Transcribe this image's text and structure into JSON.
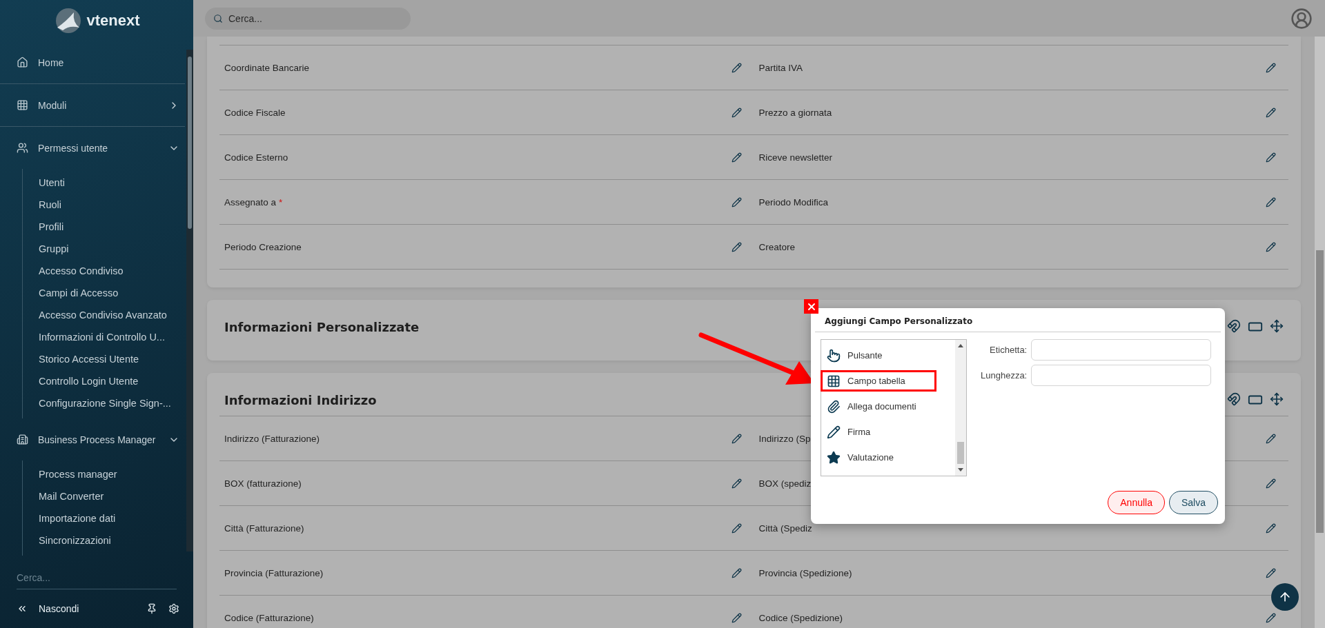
{
  "sidebar": {
    "logo_text": "vtenext",
    "menu": [
      {
        "kind": "link",
        "label": "Home"
      },
      {
        "kind": "group",
        "label": "Moduli",
        "expanded": false
      },
      {
        "kind": "group",
        "label": "Permessi utente",
        "expanded": true,
        "children": [
          "Utenti",
          "Ruoli",
          "Profili",
          "Gruppi",
          "Accesso Condiviso",
          "Campi di Accesso",
          "Accesso Condiviso Avanzato",
          "Informazioni di Controllo U...",
          "Storico Accessi Utente",
          "Controllo Login Utente",
          "Configurazione Single Sign-..."
        ]
      },
      {
        "kind": "group",
        "label": "Business Process Manager",
        "expanded": true,
        "children": [
          "Process manager",
          "Mail Converter",
          "Importazione dati",
          "Sincronizzazioni"
        ]
      }
    ],
    "search": {
      "placeholder": "Cerca..."
    },
    "hide_label": "Nascondi"
  },
  "topbar": {
    "search": {
      "placeholder": "Cerca..."
    }
  },
  "sections": [
    {
      "rows": [
        {
          "left": {
            "label": "Coordinate Bancarie"
          },
          "right": {
            "label": "Partita IVA"
          }
        },
        {
          "left": {
            "label": "Codice Fiscale"
          },
          "right": {
            "label": "Prezzo a giornata"
          }
        },
        {
          "left": {
            "label": "Codice Esterno"
          },
          "right": {
            "label": "Riceve newsletter"
          }
        },
        {
          "left": {
            "label": "Assegnato a",
            "required_mark": "*"
          },
          "right": {
            "label": "Periodo Modifica"
          }
        },
        {
          "left": {
            "label": "Periodo Creazione"
          },
          "right": {
            "label": "Creatore"
          }
        }
      ]
    },
    {
      "title": "Informazioni Personalizzate"
    },
    {
      "title": "Informazioni Indirizzo",
      "rows": [
        {
          "left": {
            "label": "Indirizzo (Fatturazione)"
          },
          "right": {
            "label": "Indirizzo (Sp"
          }
        },
        {
          "left": {
            "label": "BOX (fatturazione)"
          },
          "right": {
            "label": "BOX (spediz"
          }
        },
        {
          "left": {
            "label": "Città (Fatturazione)"
          },
          "right": {
            "label": "Città (Spediz"
          }
        },
        {
          "left": {
            "label": "Provincia (Fatturazione)"
          },
          "right": {
            "label": "Provincia (Spedizione)"
          }
        },
        {
          "left": {
            "label": "Codice (Fatturazione)"
          },
          "right": {
            "label": "Codice (Spedizione)"
          }
        }
      ]
    }
  ],
  "dialog": {
    "title": "Aggiungi Campo Personalizzato",
    "field_types": [
      {
        "label": "Pulsante",
        "highlighted": false
      },
      {
        "label": "Campo tabella",
        "highlighted": true
      },
      {
        "label": "Allega documenti",
        "highlighted": false
      },
      {
        "label": "Firma",
        "highlighted": false
      },
      {
        "label": "Valutazione",
        "highlighted": false
      }
    ],
    "fields": [
      {
        "label": "Etichetta:"
      },
      {
        "label": "Lunghezza:"
      }
    ],
    "buttons": [
      {
        "kind": "cancel",
        "label": "Annulla"
      },
      {
        "kind": "save",
        "label": "Salva"
      }
    ]
  }
}
